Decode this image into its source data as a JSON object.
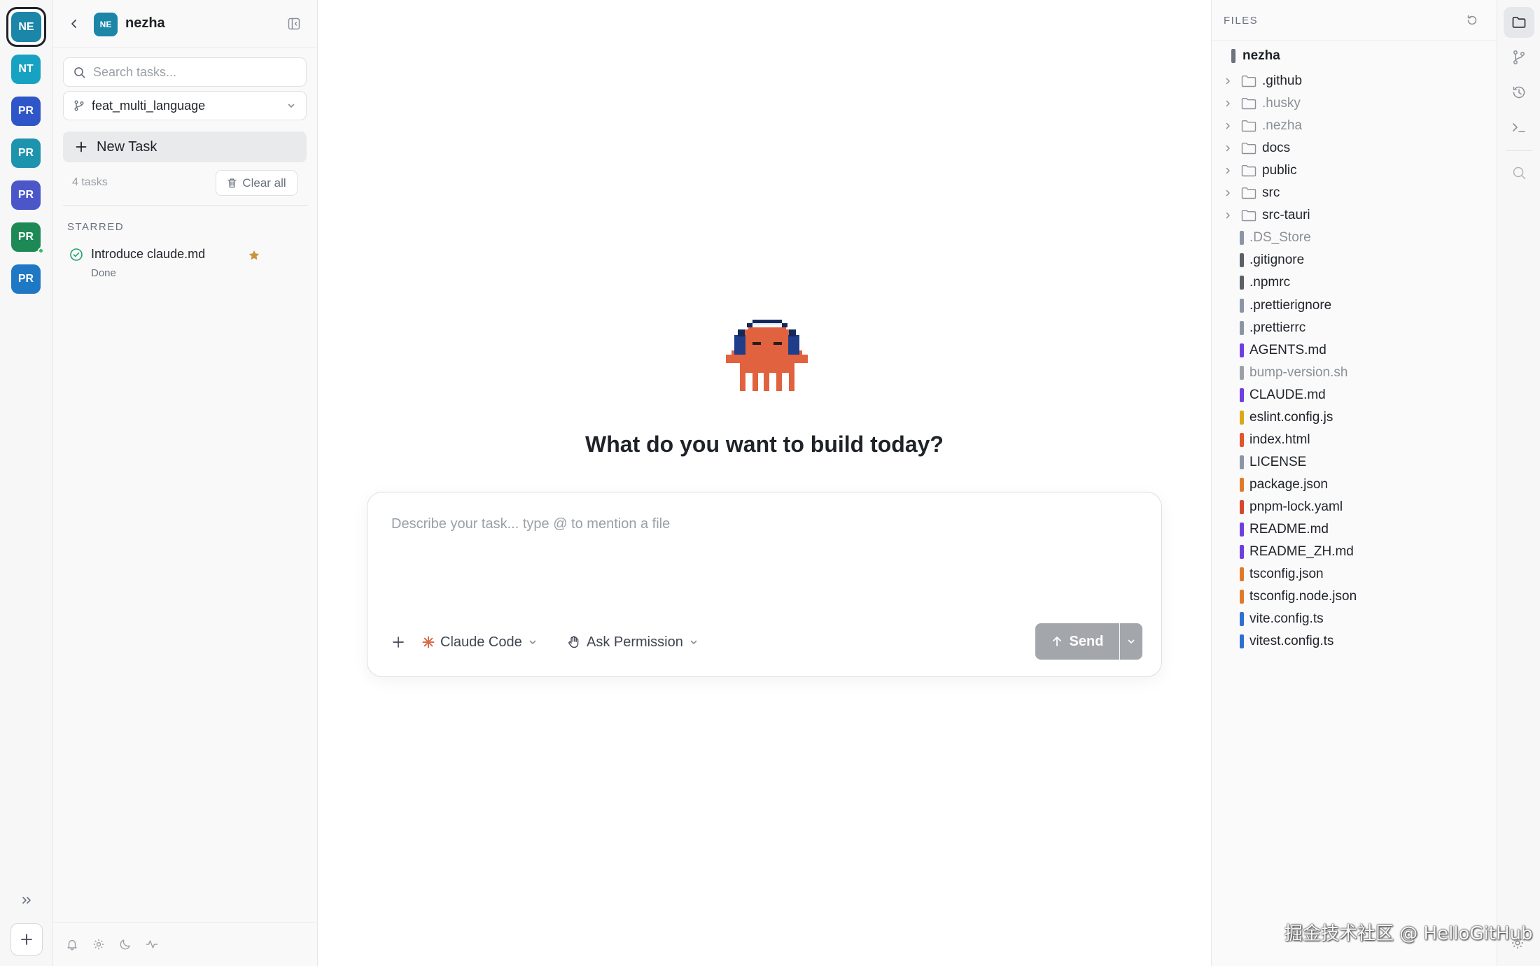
{
  "rail": {
    "projects": [
      {
        "abbr": "NE",
        "color": "#1b86a8",
        "active": true
      },
      {
        "abbr": "NT",
        "color": "#17a2c2"
      },
      {
        "abbr": "PR",
        "color": "#2f56c9"
      },
      {
        "abbr": "PR",
        "color": "#1e93ae"
      },
      {
        "abbr": "PR",
        "color": "#4b57c8"
      },
      {
        "abbr": "PR",
        "color": "#1d8a55",
        "online": true
      },
      {
        "abbr": "PR",
        "color": "#1f78c4"
      }
    ]
  },
  "sidebar": {
    "project_abbr": "NE",
    "project_name": "nezha",
    "search_placeholder": "Search tasks...",
    "branch": "feat_multi_language",
    "new_task_label": "New Task",
    "task_count": "4 tasks",
    "clear_all_label": "Clear all",
    "section_label": "STARRED",
    "tasks": [
      {
        "title": "Introduce claude.md",
        "status": "Done",
        "starred": true
      }
    ]
  },
  "main": {
    "headline": "What do you want to build today?",
    "composer_placeholder": "Describe your task... type @ to mention a file",
    "agent_label": "Claude Code",
    "permission_label": "Ask Permission",
    "send_label": "Send"
  },
  "files": {
    "title": "FILES",
    "root": "nezha",
    "folders": [
      ".github",
      ".husky",
      ".nezha",
      "docs",
      "public",
      "src",
      "src-tauri"
    ],
    "dimmed_folders": [
      ".husky",
      ".nezha"
    ],
    "entries": [
      {
        "name": ".DS_Store",
        "color": "#8b95a6",
        "dimmed": true
      },
      {
        "name": ".gitignore",
        "color": "#5b6068"
      },
      {
        "name": ".npmrc",
        "color": "#5b6068"
      },
      {
        "name": ".prettierignore",
        "color": "#8b95a6"
      },
      {
        "name": ".prettierrc",
        "color": "#8b95a6"
      },
      {
        "name": "AGENTS.md",
        "color": "#6d3fe0"
      },
      {
        "name": "bump-version.sh",
        "color": "#9aa0a6",
        "dimmed": true
      },
      {
        "name": "CLAUDE.md",
        "color": "#6d3fe0"
      },
      {
        "name": "eslint.config.js",
        "color": "#d9a91a"
      },
      {
        "name": "index.html",
        "color": "#e0552a"
      },
      {
        "name": "LICENSE",
        "color": "#8b95a6"
      },
      {
        "name": "package.json",
        "color": "#e07a2a"
      },
      {
        "name": "pnpm-lock.yaml",
        "color": "#d6462f"
      },
      {
        "name": "README.md",
        "color": "#6d3fe0"
      },
      {
        "name": "README_ZH.md",
        "color": "#6d3fe0"
      },
      {
        "name": "tsconfig.json",
        "color": "#e07a2a"
      },
      {
        "name": "tsconfig.node.json",
        "color": "#e07a2a"
      },
      {
        "name": "vite.config.ts",
        "color": "#2f6fd0"
      },
      {
        "name": "vitest.config.ts",
        "color": "#2f6fd0"
      }
    ]
  },
  "activity": {
    "icons": [
      "folder-icon",
      "git-branch-icon",
      "history-icon",
      "terminal-icon",
      "search-icon"
    ]
  },
  "watermark": "掘金技术社区 @ HelloGitHub"
}
